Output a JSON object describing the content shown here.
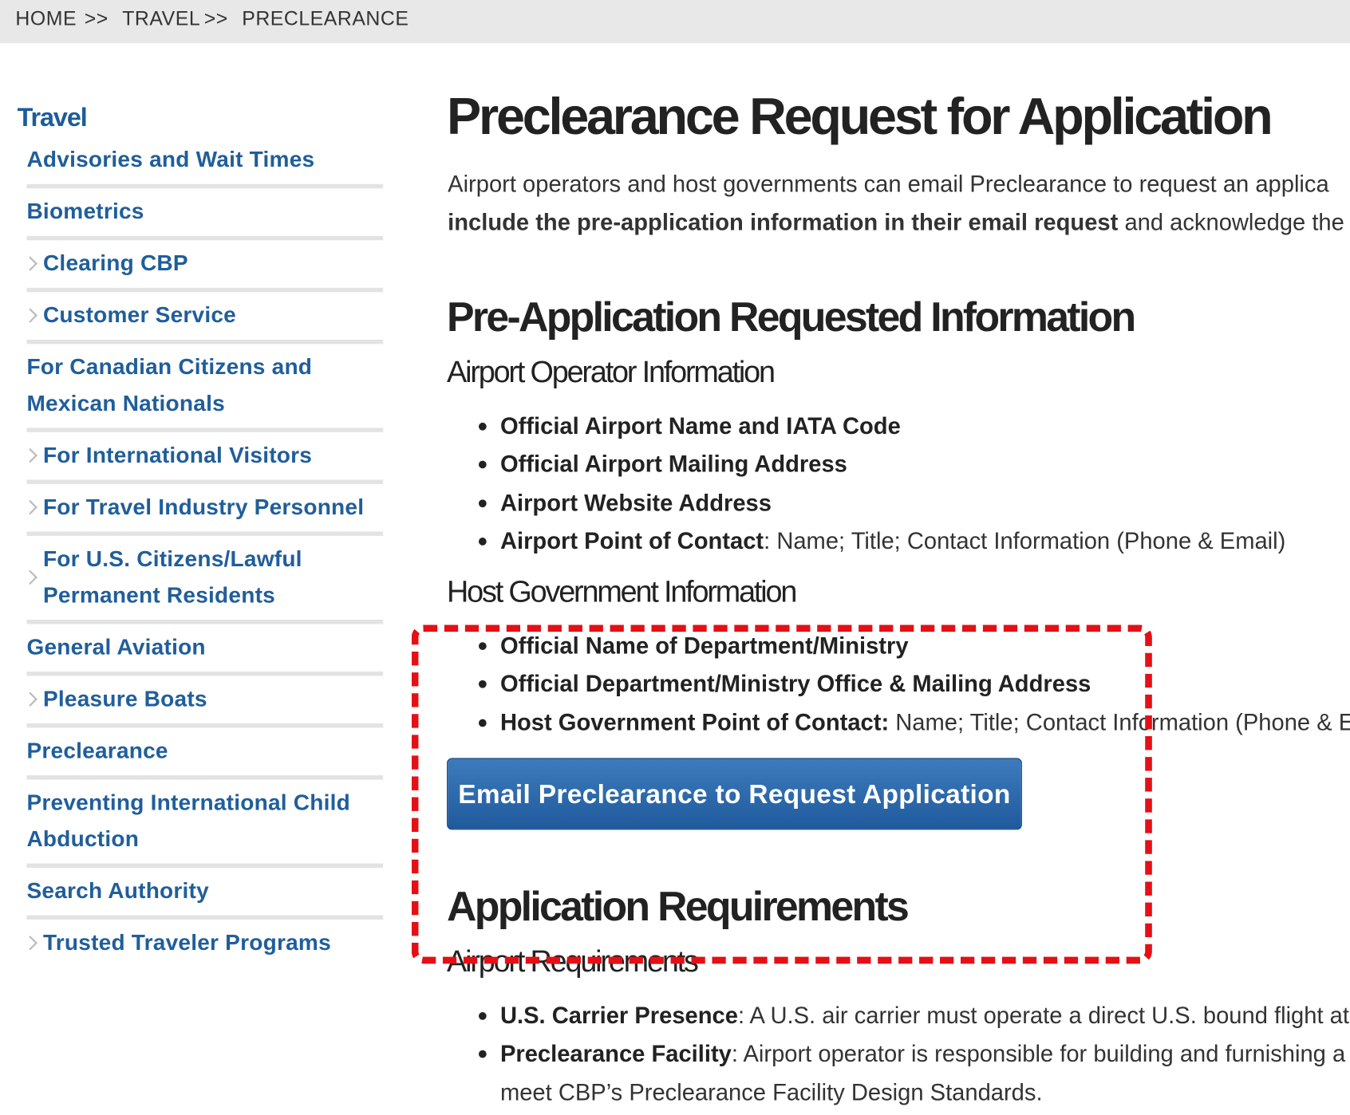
{
  "breadcrumb": {
    "items": [
      "HOME",
      "TRAVEL",
      "PRECLEARANCE"
    ],
    "separator": ">>"
  },
  "sidebar": {
    "title": "Travel",
    "items": [
      {
        "label": "Advisories and Wait Times",
        "has_children": false
      },
      {
        "label": "Biometrics",
        "has_children": false
      },
      {
        "label": "Clearing CBP",
        "has_children": true
      },
      {
        "label": "Customer Service",
        "has_children": true
      },
      {
        "label_line1": "For Canadian Citizens and",
        "label_line2": "Mexican Nationals",
        "has_children": false
      },
      {
        "label": "For International Visitors",
        "has_children": true
      },
      {
        "label": "For Travel Industry Personnel",
        "has_children": true
      },
      {
        "label_line1": "For U.S. Citizens/Lawful",
        "label_line2": "Permanent Residents",
        "has_children": true
      },
      {
        "label": "General Aviation",
        "has_children": false
      },
      {
        "label": "Pleasure Boats",
        "has_children": true
      },
      {
        "label": "Preclearance",
        "has_children": false
      },
      {
        "label_line1": "Preventing International Child",
        "label_line2": "Abduction",
        "has_children": false
      },
      {
        "label": "Search Authority",
        "has_children": false
      },
      {
        "label": "Trusted Traveler Programs",
        "has_children": true
      }
    ]
  },
  "main": {
    "title": "Preclearance Request for Application",
    "intro_line1": "Airport operators and host governments can email Preclearance to request an applica",
    "intro_line2_bold": "include the pre-application information in their email request",
    "intro_line2_rest": " and acknowledge the",
    "pre_app_heading": "Pre-Application Requested Information",
    "airport_operator": {
      "heading": "Airport Operator Information",
      "items": [
        {
          "bold": "Official Airport Name and IATA Code",
          "text": ""
        },
        {
          "bold": "Official Airport Mailing Address",
          "text": ""
        },
        {
          "bold": "Airport Website Address",
          "text": ""
        },
        {
          "bold": "Airport Point of Contact",
          "text": ": Name; Title; Contact Information (Phone & Email)"
        }
      ]
    },
    "host_government": {
      "heading": "Host Government Information",
      "items": [
        {
          "bold": "Official Name of Department/Ministry",
          "text": ""
        },
        {
          "bold": "Official Department/Ministry Office & Mailing Address",
          "text": ""
        },
        {
          "bold": "Host Government Point of Contact:",
          "text": " Name; Title; Contact Information (Phone & Em"
        }
      ]
    },
    "email_button": "Email Preclearance to Request Application",
    "app_req_heading": "Application Requirements",
    "airport_requirements": {
      "heading": "Airport Requirements",
      "items": [
        {
          "bold": "U.S. Carrier Presence",
          "text": ": A U.S. air carrier must operate a direct U.S. bound flight at th"
        },
        {
          "bold": "Preclearance Facility",
          "text": ": Airport operator is responsible for building and furnishing a"
        }
      ],
      "continuation": "meet CBP’s Preclearance Facility Design Standards."
    }
  },
  "colors": {
    "nav_link": "#205e9b",
    "button_bg": "#2a66a8",
    "annotation": "#e41016"
  }
}
